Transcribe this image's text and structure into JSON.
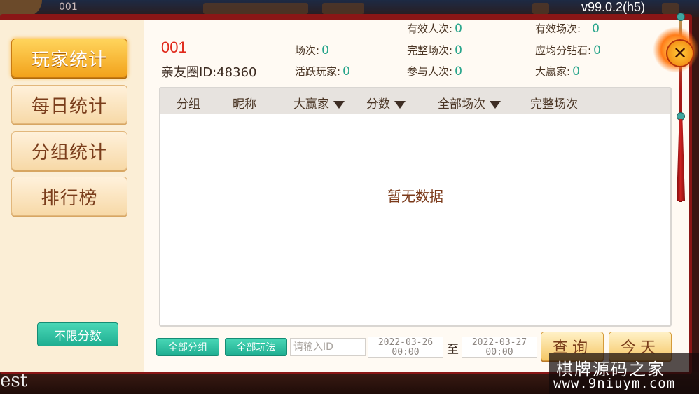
{
  "version": "v99.0.2(h5)",
  "background": {
    "top_number": "001",
    "bottom_text": "est"
  },
  "sidebar": {
    "items": [
      {
        "label": "玩家统计",
        "active": true
      },
      {
        "label": "每日统计",
        "active": false
      },
      {
        "label": "分组统计",
        "active": false
      },
      {
        "label": "排行榜",
        "active": false
      }
    ],
    "filter_button": "不限分数"
  },
  "club": {
    "number": "001",
    "id_text": "亲友圈ID:48360"
  },
  "stats": {
    "rounds_label": "场次:",
    "rounds_value": "0",
    "active_players_label": "活跃玩家:",
    "active_players_value": "0",
    "valid_people_label": "有效人次:",
    "valid_people_value": "0",
    "complete_rounds_label": "完整场次:",
    "complete_rounds_value": "0",
    "participants_label": "参与人次:",
    "participants_value": "0",
    "valid_rounds_label": "有效场次:",
    "valid_rounds_value": "0",
    "diamonds_label": "应均分钻石:",
    "diamonds_value": "0",
    "big_winner_label": "大赢家:",
    "big_winner_value": "0"
  },
  "table": {
    "headers": [
      "分组",
      "昵称",
      "大赢家",
      "分数",
      "全部场次",
      "完整场次"
    ],
    "empty_text": "暂无数据"
  },
  "filters": {
    "group_button": "全部分组",
    "mode_button": "全部玩法",
    "id_placeholder": "请输入ID",
    "date_from": "2022-03-26 00:00",
    "date_from_line1": "2022-03-26",
    "date_from_line2": "00:00",
    "to_label": "至",
    "date_to_line1": "2022-03-27",
    "date_to_line2": "00:00",
    "query_button": "查询",
    "today_button": "今天"
  },
  "close_icon": "close-icon",
  "watermark": {
    "title": "棋牌源码之家",
    "url": "www.9niuym.com"
  },
  "colors": {
    "accent_gold": "#f2a21b",
    "teal": "#27a58b",
    "club_red": "#e0291a",
    "frame_red": "#8a1616"
  }
}
